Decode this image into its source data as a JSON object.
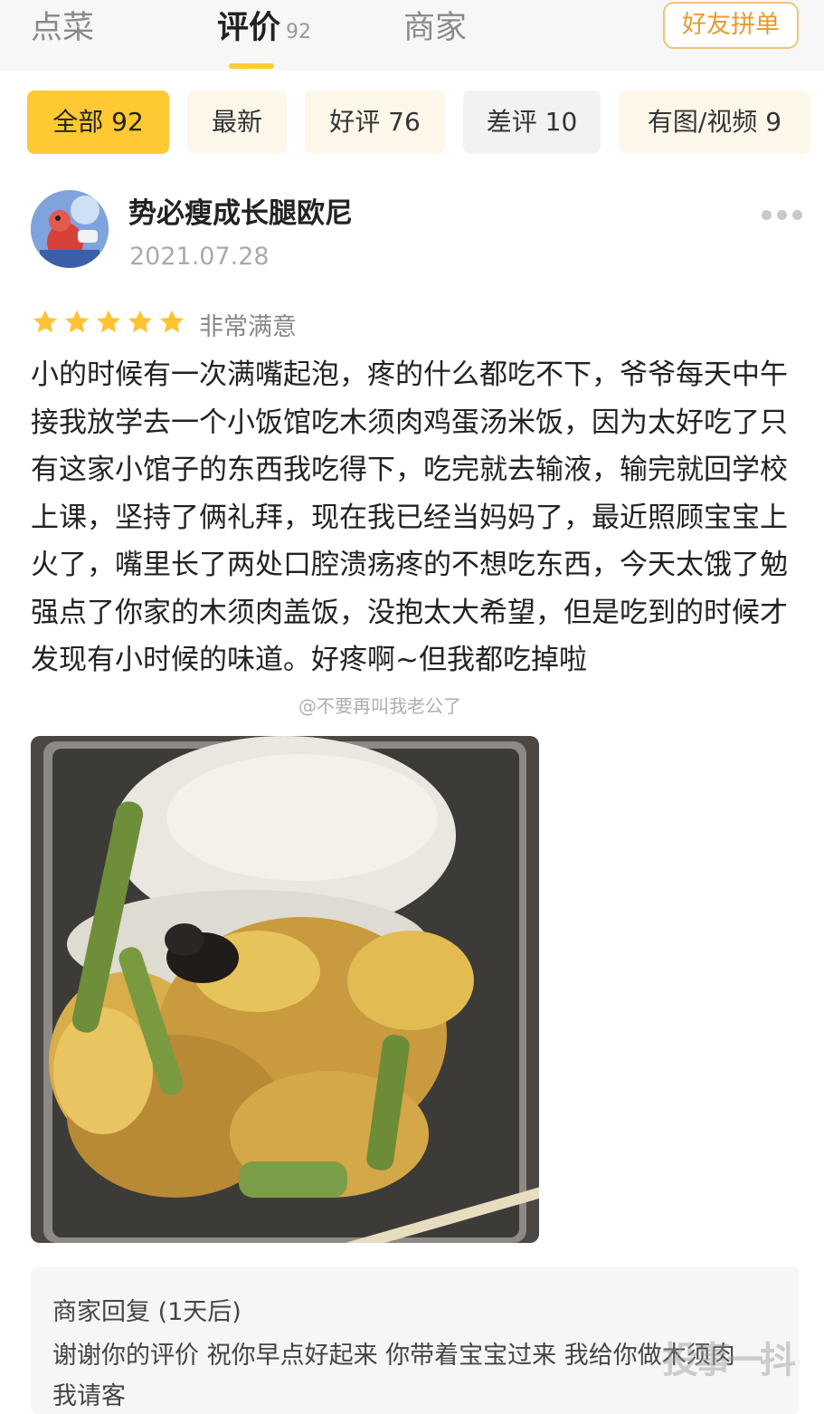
{
  "tabs": [
    {
      "label": "点菜"
    },
    {
      "label": "评价",
      "count": "92"
    },
    {
      "label": "商家"
    }
  ],
  "friend_button": "好友拼单",
  "filters": [
    {
      "label": "全部 92",
      "active": true
    },
    {
      "label": "最新"
    },
    {
      "label": "好评 76"
    },
    {
      "label": "差评 10"
    },
    {
      "label": "有图/视频 9"
    }
  ],
  "review": {
    "username": "势必瘦成长腿欧尼",
    "date": "2021.07.28",
    "rating": 5,
    "rating_max": 5,
    "rating_text": "非常满意",
    "text": "小的时候有一次满嘴起泡，疼的什么都吃不下，爷爷每天中午接我放学去一个小饭馆吃木须肉鸡蛋汤米饭，因为太好吃了只有这家小馆子的东西我吃得下，吃完就去输液，输完就回学校上课，坚持了俩礼拜，现在我已经当妈妈了，最近照顾宝宝上火了，嘴里长了两处口腔溃疡疼的不想吃东西，今天太饿了勉强点了你家的木须肉盖饭，没抱太大希望，但是吃到的时候才发现有小时候的味道。好疼啊~但我都吃掉啦",
    "watermark": "@不要再叫我老公了",
    "star_color": "#ffc233"
  },
  "merchant_reply": {
    "title": "商家回复 (1天后)",
    "text": "谢谢你的评价 祝你早点好起来 你带着宝宝过来 我给你做木须肉 我请客"
  },
  "corner_watermark": "投事一抖",
  "colors": {
    "accent": "#ffc933",
    "friend_button": "#e89a2c"
  }
}
